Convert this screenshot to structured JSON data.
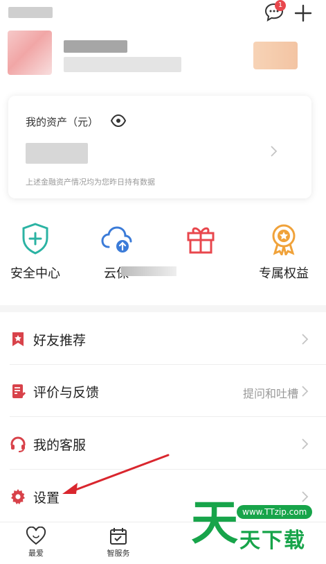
{
  "header": {
    "message_badge": "1",
    "message_icon": "chat-bubble-icon",
    "add_icon": "plus-icon"
  },
  "assets": {
    "title": "我的资产（元）",
    "eye_icon": "eye-icon",
    "note": "上述金融资产情况均为您昨日持有数据"
  },
  "services": [
    {
      "label": "安全中心",
      "icon": "shield-plus-icon",
      "color": "#2bb3a3"
    },
    {
      "label": "云保",
      "icon": "cloud-upload-icon",
      "color": "#3b7bd8"
    },
    {
      "label": "",
      "icon": "gift-icon",
      "color": "#e8474d"
    },
    {
      "label": "专属权益",
      "icon": "medal-icon",
      "color": "#f0a23a"
    }
  ],
  "menu": [
    {
      "label": "好友推荐",
      "right": "",
      "icon": "bookmark-star-icon",
      "color": "#d8424a"
    },
    {
      "label": "评价与反馈",
      "right": "提问和吐槽",
      "icon": "document-edit-icon",
      "color": "#d8424a"
    },
    {
      "label": "我的客服",
      "right": "",
      "icon": "headset-icon",
      "color": "#d8424a"
    },
    {
      "label": "设置",
      "right": "",
      "icon": "gear-icon",
      "color": "#d8424a"
    }
  ],
  "bottom_tabs": [
    {
      "label": "最爱",
      "icon": "heart-icon"
    },
    {
      "label": "智服务",
      "icon": "calendar-icon"
    }
  ],
  "watermark": {
    "big_char": "天",
    "url": "www.TTzip.com",
    "text": "天下载"
  }
}
